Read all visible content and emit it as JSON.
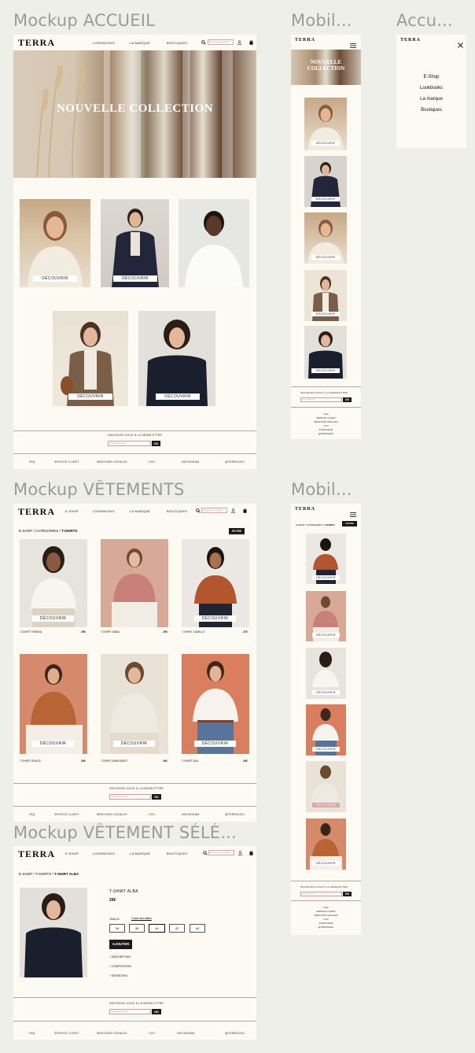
{
  "titles": {
    "accueil": "Mockup ACCUEIL",
    "mobile1": "Mobil...",
    "menu": "Accu...",
    "vetements": "Mockup VÊTEMENTS",
    "mobile2": "Mobil...",
    "selected": "Mockup VÊTEMENT SÉLÉ..."
  },
  "brand": "TERRA",
  "nav": {
    "eshop": "E-SHOP",
    "lookbooks": "LOOKBOOKS",
    "marque": "LA MARQUE",
    "boutiques": "BOUTIQUES",
    "search_placeholder": "Rechercher un produit"
  },
  "hero": {
    "title": "NOUVELLE COLLECTION",
    "mobile_title": "NOUVELLE COLLECTION"
  },
  "discover": "DÉCOUVRIR",
  "newsletter": {
    "title": "INSCRIVEZ-VOUS À LA NEWSLETTER",
    "placeholder": "Votre adresse mail",
    "ok": "OK"
  },
  "footer": [
    "FAQ",
    "SERVICE CLIENT",
    "MENTIONS LÉGALES",
    "CGV",
    "INSTAGRAM",
    "@TERRA2021"
  ],
  "menu": {
    "items": [
      "E-Shop",
      "Lookbooks",
      "La marque",
      "Boutiques"
    ]
  },
  "breadcrumb": {
    "a": "E-SHOP",
    "b": "CATÉGORIES",
    "c": "T-SHIRTS",
    "sep": "/"
  },
  "filter": "FILTRE",
  "products": [
    {
      "name": "T-SHIRT TRINIKA",
      "price": "29€"
    },
    {
      "name": "T-SHIRT SABA",
      "price": "29€"
    },
    {
      "name": "T-SHIRT CAMILLE",
      "price": "27€"
    },
    {
      "name": "T-SHIRT GRACE",
      "price": "29€"
    },
    {
      "name": "T-SHIRT MARGARET",
      "price": "29€"
    },
    {
      "name": "T-SHIRT ADA",
      "price": "29€"
    }
  ],
  "product": {
    "crumb_a": "E-SHOP",
    "crumb_b": "T-SHIRTS",
    "crumb_c": "T-SHIRT ALBA",
    "name": "T-SHIRT ALBA",
    "price": "29€",
    "size_label": "TAILLE",
    "guide": "Guide des tailles",
    "sizes": [
      "34",
      "38",
      "40",
      "42",
      "44"
    ],
    "add": "AJOUTER",
    "accordions": [
      "+ DESCRIPTION",
      "+ COMPOSITION",
      "+ ENTRETIEN"
    ]
  }
}
